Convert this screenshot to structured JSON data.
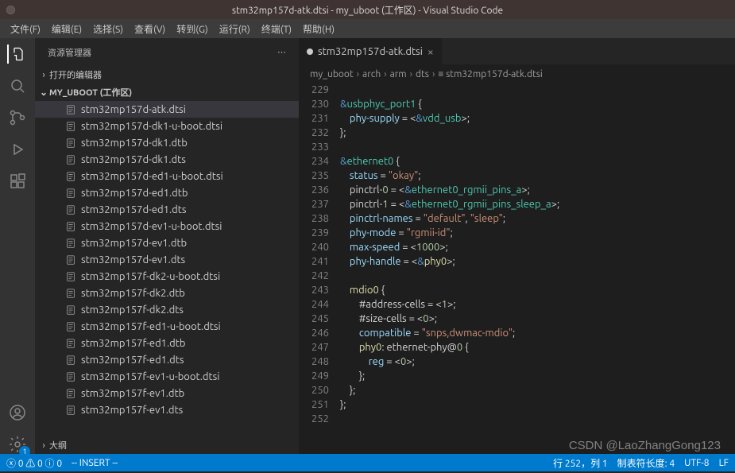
{
  "title": "stm32mp157d-atk.dtsi - my_uboot (工作区) - Visual Studio Code",
  "menu": [
    "文件(F)",
    "编辑(E)",
    "选择(S)",
    "查看(V)",
    "转到(G)",
    "运行(R)",
    "终端(T)",
    "帮助(H)"
  ],
  "sidebar": {
    "header": "资源管理器",
    "openEditors": "打开的编辑器",
    "workspace": "MY_UBOOT (工作区)",
    "outline": "大纲",
    "files": [
      "stm32mp157d-atk.dtsi",
      "stm32mp157d-dk1-u-boot.dtsi",
      "stm32mp157d-dk1.dtb",
      "stm32mp157d-dk1.dts",
      "stm32mp157d-ed1-u-boot.dtsi",
      "stm32mp157d-ed1.dtb",
      "stm32mp157d-ed1.dts",
      "stm32mp157d-ev1-u-boot.dtsi",
      "stm32mp157d-ev1.dtb",
      "stm32mp157d-ev1.dts",
      "stm32mp157f-dk2-u-boot.dtsi",
      "stm32mp157f-dk2.dtb",
      "stm32mp157f-dk2.dts",
      "stm32mp157f-ed1-u-boot.dtsi",
      "stm32mp157f-ed1.dtb",
      "stm32mp157f-ed1.dts",
      "stm32mp157f-ev1-u-boot.dtsi",
      "stm32mp157f-ev1.dtb",
      "stm32mp157f-ev1.dts"
    ]
  },
  "tab": {
    "name": "stm32mp157d-atk.dtsi"
  },
  "breadcrumb": [
    "my_uboot",
    "arch",
    "arm",
    "dts",
    "stm32mp157d-atk.dtsi"
  ],
  "code": {
    "start": 229,
    "lines": [
      "",
      "&usbphyc_port1 {",
      "    phy-supply = <&vdd_usb>;",
      "};",
      "",
      "&ethernet0 {",
      "    status = \"okay\";",
      "    pinctrl-0 = <&ethernet0_rgmii_pins_a>;",
      "    pinctrl-1 = <&ethernet0_rgmii_pins_sleep_a>;",
      "    pinctrl-names = \"default\", \"sleep\";",
      "    phy-mode = \"rgmii-id\";",
      "    max-speed = <1000>;",
      "    phy-handle = <&phy0>;",
      "",
      "    mdio0 {",
      "        #address-cells = <1>;",
      "        #size-cells = <0>;",
      "        compatible = \"snps,dwmac-mdio\";",
      "        phy0: ethernet-phy@0 {",
      "            reg = <0>;",
      "        };",
      "    };",
      "};",
      ""
    ]
  },
  "status": {
    "errors": "0",
    "warnings": "0",
    "info": "0",
    "mode": "-- INSERT --",
    "pos": "行 252，列 1",
    "tab": "制表符长度: 4",
    "enc": "UTF-8",
    "eol": "LF"
  },
  "watermark": "CSDN @LaoZhangGong123"
}
